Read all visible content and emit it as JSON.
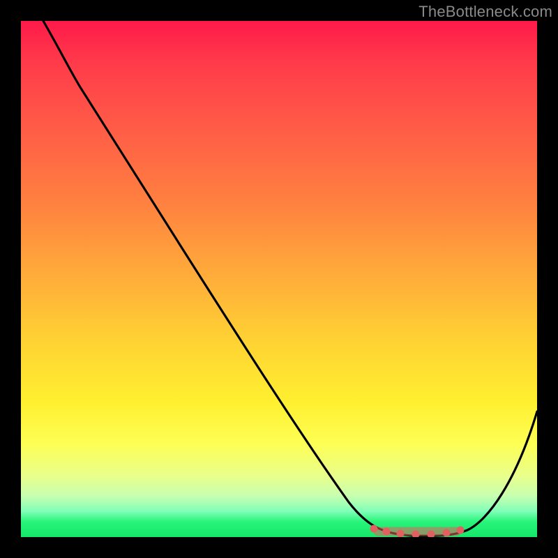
{
  "watermark": "TheBottleneck.com",
  "chart_data": {
    "type": "line",
    "title": "",
    "xlabel": "",
    "ylabel": "",
    "xlim": [
      0,
      1
    ],
    "ylim": [
      0,
      1
    ],
    "grid": false,
    "legend": false,
    "colors": {
      "top": "#ff1a4a",
      "upper_mid": "#ff8040",
      "mid": "#ffd233",
      "lower_mid": "#fdff55",
      "bottom": "#14e86a",
      "curve": "#000000",
      "marker": "#e0615f"
    },
    "series": [
      {
        "name": "bottleneck-curve",
        "x": [
          0.0,
          0.05,
          0.1,
          0.15,
          0.2,
          0.3,
          0.4,
          0.5,
          0.6,
          0.68,
          0.72,
          0.76,
          0.8,
          0.84,
          0.88,
          0.92,
          0.96,
          1.0
        ],
        "y": [
          1.0,
          0.96,
          0.91,
          0.85,
          0.79,
          0.66,
          0.53,
          0.4,
          0.27,
          0.14,
          0.07,
          0.02,
          0.0,
          0.0,
          0.02,
          0.08,
          0.17,
          0.28
        ]
      },
      {
        "name": "optimal-range-markers",
        "x": [
          0.69,
          0.72,
          0.75,
          0.78,
          0.81,
          0.84,
          0.865
        ],
        "y": [
          0.015,
          0.01,
          0.008,
          0.006,
          0.006,
          0.008,
          0.012
        ]
      }
    ]
  }
}
